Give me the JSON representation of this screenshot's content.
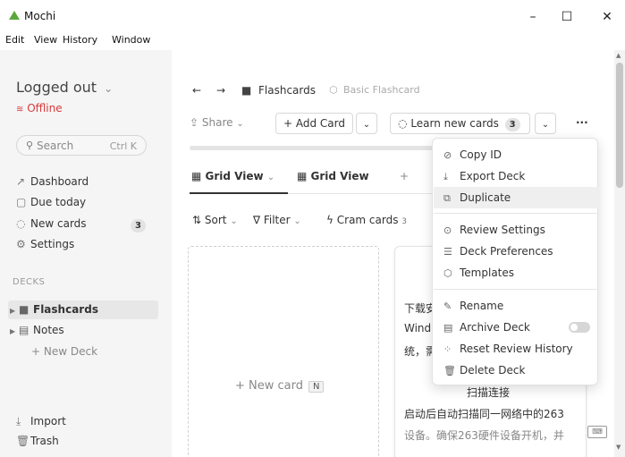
{
  "window": {
    "title": "Mochi",
    "brand_color": "#5aa83a",
    "minimize": "–",
    "maximize": "☐",
    "close": "✕"
  },
  "menubar": [
    "Edit",
    "View",
    "History",
    "Window"
  ],
  "sidebar": {
    "account": "Logged out",
    "account_caret": "⌄",
    "status": "Offline",
    "status_color": "#d93a3a",
    "search_placeholder": "Search",
    "search_shortcut": "Ctrl K",
    "nav": [
      {
        "label": "Dashboard",
        "icon": "trend-icon"
      },
      {
        "label": "Due today",
        "icon": "lock-icon"
      },
      {
        "label": "New cards",
        "icon": "dashed-circle-icon",
        "badge": "3"
      },
      {
        "label": "Settings",
        "icon": "gear-icon"
      }
    ],
    "decks_heading": "DECKS",
    "decks": [
      {
        "label": "Flashcards",
        "selected": true
      },
      {
        "label": "Notes",
        "selected": false
      }
    ],
    "new_deck": "+ New Deck",
    "import": "Import",
    "trash": "Trash"
  },
  "main": {
    "breadcrumb": {
      "deck": "Flashcards",
      "template": "Basic Flashcard"
    },
    "toolbar": {
      "share": "Share",
      "add_card": "+ Add Card",
      "learn": "Learn new cards",
      "learn_count": "3",
      "more": "···"
    },
    "tabs": [
      {
        "label": "Grid View",
        "active": true
      },
      {
        "label": "Grid View",
        "active": false
      }
    ],
    "add_tab": "+",
    "filters": {
      "sort": "Sort",
      "filter": "Filter",
      "cram": "Cram cards",
      "cram_count": "3"
    },
    "new_card": "+ New card",
    "new_card_key": "N",
    "card_lines": [
      "下载安",
      "Wind",
      "统，需",
      "扫描连接",
      "启动后自动扫描同一网络中的263",
      "设备。确保263硬件设备开机，并"
    ]
  },
  "dropdown": {
    "groups": [
      [
        {
          "label": "Copy ID",
          "icon": "link-icon"
        },
        {
          "label": "Export Deck",
          "icon": "export-icon"
        },
        {
          "label": "Duplicate",
          "icon": "duplicate-icon",
          "highlighted": true
        }
      ],
      [
        {
          "label": "Review Settings",
          "icon": "check-circle-icon"
        },
        {
          "label": "Deck Preferences",
          "icon": "sliders-icon"
        },
        {
          "label": "Templates",
          "icon": "cube-icon"
        }
      ],
      [
        {
          "label": "Rename",
          "icon": "pencil-icon"
        },
        {
          "label": "Archive Deck",
          "icon": "archive-icon",
          "toggle": false
        },
        {
          "label": "Reset Review History",
          "icon": "spinner-icon"
        },
        {
          "label": "Delete Deck",
          "icon": "trash-icon"
        }
      ]
    ]
  }
}
